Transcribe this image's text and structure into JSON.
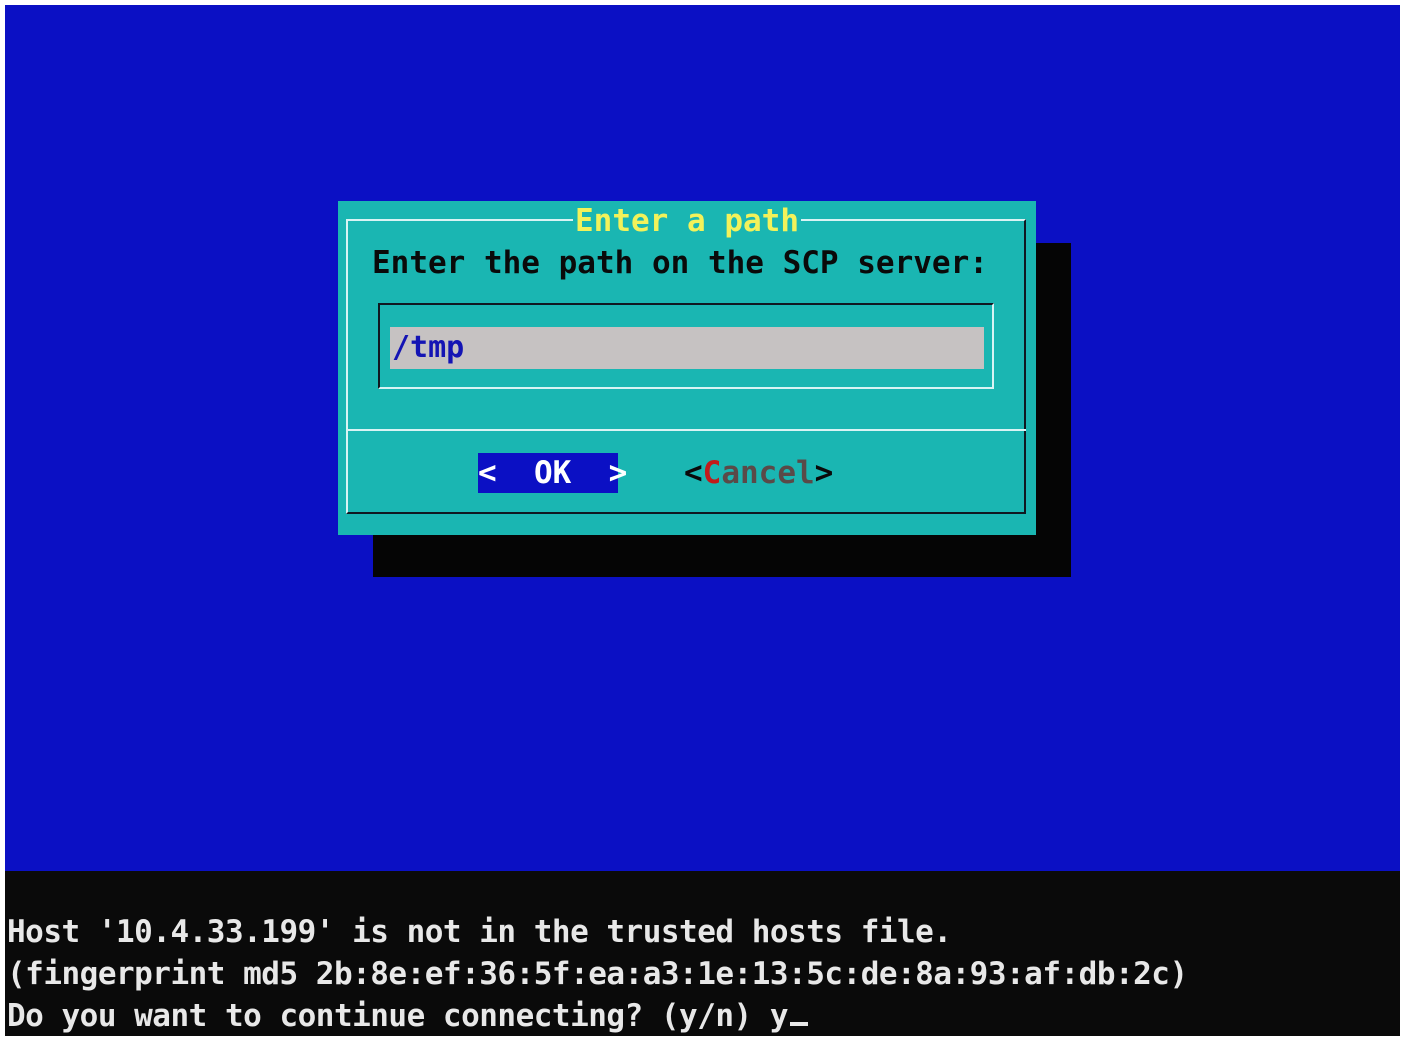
{
  "dialog": {
    "title": "Enter a path",
    "prompt": "Enter the path on the SCP server:",
    "input_value": "/tmp",
    "ok_button": {
      "left_bracket": "<",
      "label": "OK",
      "right_bracket": ">"
    },
    "cancel_button": {
      "left_bracket": "<",
      "hotkey": "C",
      "label_rest": "ancel",
      "right_bracket": ">"
    }
  },
  "console": {
    "lines": [
      "Host '10.4.33.199' is not in the trusted hosts file.",
      "(fingerprint md5 2b:8e:ef:36:5f:ea:a3:1e:13:5c:de:8a:93:af:db:2c)",
      "Do you want to continue connecting? (y/n) y"
    ]
  },
  "colors": {
    "background": "#0b10c4",
    "dialog": "#1ab6b2",
    "title": "#f2f25a",
    "input_field": "#c6c2c2",
    "selected_button": "#0b10c4",
    "hotkey": "#c21a1a",
    "console_background": "#0a0a0a"
  }
}
